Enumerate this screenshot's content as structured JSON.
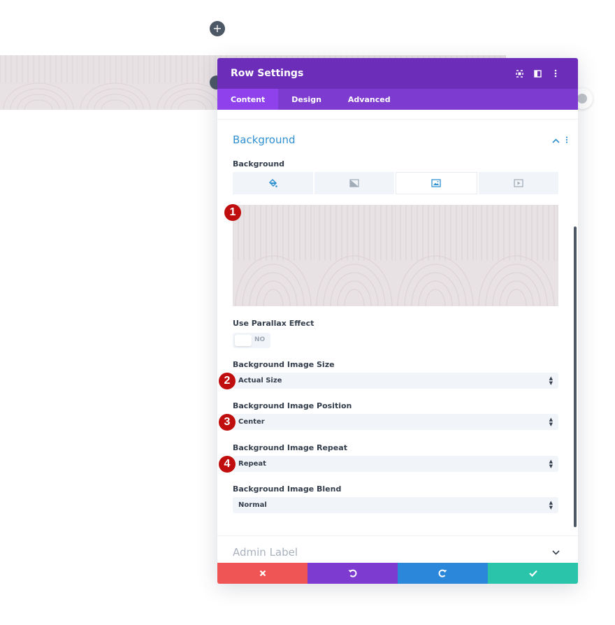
{
  "window": {
    "title": "Row Settings"
  },
  "tabs": [
    {
      "label": "Content",
      "active": true
    },
    {
      "label": "Design",
      "active": false
    },
    {
      "label": "Advanced",
      "active": false
    }
  ],
  "section": {
    "title": "Background"
  },
  "fields": {
    "background_label": "Background",
    "parallax_label": "Use Parallax Effect",
    "parallax_value": "NO",
    "size_label": "Background Image Size",
    "size_value": "Actual Size",
    "position_label": "Background Image Position",
    "position_value": "Center",
    "repeat_label": "Background Image Repeat",
    "repeat_value": "Repeat",
    "blend_label": "Background Image Blend",
    "blend_value": "Normal"
  },
  "admin": {
    "label": "Admin Label"
  },
  "markers": [
    "1",
    "2",
    "3",
    "4"
  ],
  "colors": {
    "header": "#6c2eb9",
    "tabs": "#7d3bcf",
    "active_tab": "#8f42ec",
    "section_title": "#2e8fd1",
    "cancel": "#ef5555",
    "undo": "#7e3bd0",
    "redo": "#2b87da",
    "save": "#29c4a9",
    "marker": "#c00d0d",
    "pattern_bg": "#e8e2e4"
  },
  "icons": {
    "fit": "expand-icon",
    "layout": "sidebar-layout-icon",
    "more": "kebab-icon",
    "color": "paint-bucket-icon",
    "gradient": "gradient-icon",
    "image": "image-icon",
    "video": "video-icon",
    "cancel": "close-icon",
    "undo": "undo-icon",
    "redo": "redo-icon",
    "save": "check-icon"
  }
}
